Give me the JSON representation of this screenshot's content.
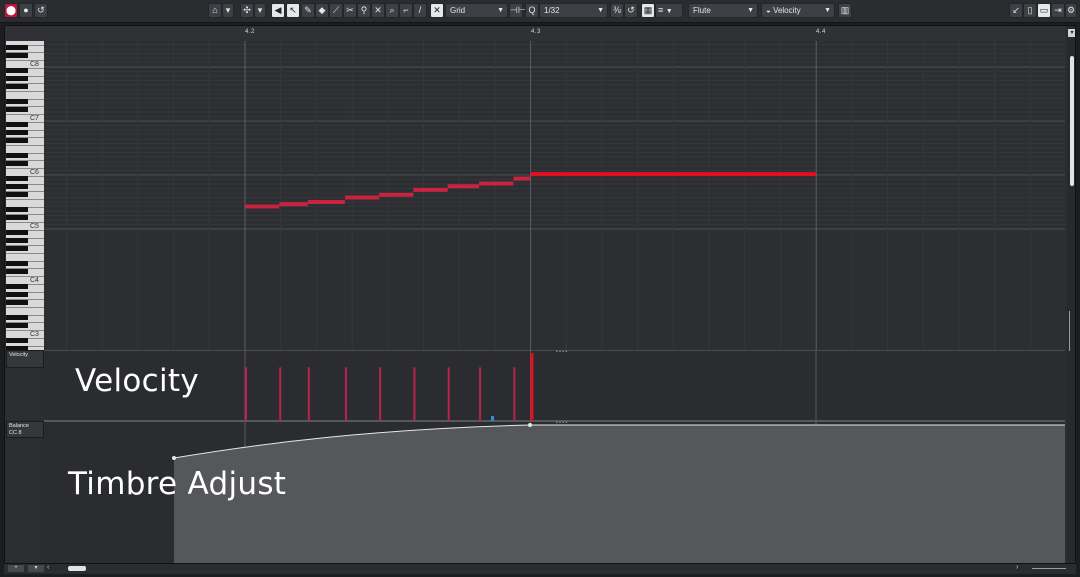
{
  "toolbar": {
    "snap_mode": "Grid",
    "quantize": "1/32",
    "instrument": "Flute",
    "lane_param": "Velocity"
  },
  "ruler": {
    "markers": [
      "4.2",
      "4.3",
      "4.4"
    ]
  },
  "keyboard": {
    "octave_labels": [
      "C8",
      "C7",
      "C6",
      "C5",
      "C4",
      "C3"
    ]
  },
  "lanes": {
    "velocity": {
      "label": "Velocity"
    },
    "controller": {
      "label_line1": "Balance",
      "label_line2": "CC 8"
    }
  },
  "overlay": {
    "velocity_caption": "Velocity",
    "timbre_caption": "Timbre Adjust"
  },
  "notes": [
    {
      "start": 4.2,
      "end": 4.212,
      "pitch": 65.0
    },
    {
      "start": 4.212,
      "end": 4.222,
      "pitch": 65.5
    },
    {
      "start": 4.222,
      "end": 4.235,
      "pitch": 66.0
    },
    {
      "start": 4.235,
      "end": 4.247,
      "pitch": 67.0
    },
    {
      "start": 4.247,
      "end": 4.259,
      "pitch": 67.6
    },
    {
      "start": 4.259,
      "end": 4.271,
      "pitch": 68.7
    },
    {
      "start": 4.271,
      "end": 4.282,
      "pitch": 69.5
    },
    {
      "start": 4.282,
      "end": 4.294,
      "pitch": 70.1
    },
    {
      "start": 4.294,
      "end": 4.3,
      "pitch": 71.2
    },
    {
      "start": 4.3,
      "end": 4.4,
      "pitch": 72.2
    }
  ],
  "velocities": [
    {
      "pos": 4.2,
      "value": 0.79
    },
    {
      "pos": 4.212,
      "value": 0.79
    },
    {
      "pos": 4.222,
      "value": 0.79
    },
    {
      "pos": 4.235,
      "value": 0.79
    },
    {
      "pos": 4.247,
      "value": 0.79
    },
    {
      "pos": 4.259,
      "value": 0.79
    },
    {
      "pos": 4.271,
      "value": 0.79
    },
    {
      "pos": 4.282,
      "value": 0.79
    },
    {
      "pos": 4.294,
      "value": 0.79
    },
    {
      "pos": 4.3,
      "value": 1.0
    }
  ],
  "colors": {
    "note": "#c8233f",
    "note_active": "#e01020",
    "velocity": "#b9254a",
    "accent": "#c4143a"
  }
}
